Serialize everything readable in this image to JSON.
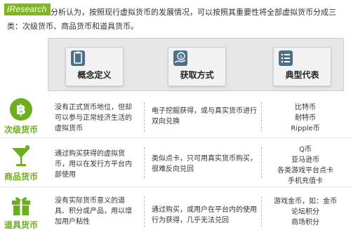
{
  "logo": {
    "i": "i",
    "rest": "Research"
  },
  "intro": "分析认为，按照现行虚拟货币的发展情况，可以按照其重要性将全部虚拟货币分成三类：次级货币、商品货币和道具货币。",
  "columns": [
    {
      "label": "概念定义",
      "icon": "clipboard-icon"
    },
    {
      "label": "获取方式",
      "icon": "money-hand-icon"
    },
    {
      "label": "典型代表",
      "icon": "list-icon"
    }
  ],
  "rows": [
    {
      "category": "次级货币",
      "icon": "bitcoin-icon",
      "definition": "没有正式货币地位，但却可以参与正常经济生活的虚拟货币",
      "acquisition": "电子挖掘获得，或与真实货币进行双向兑换",
      "examples": [
        "比特币",
        "耐特币",
        "Ripple币"
      ]
    },
    {
      "category": "商品货币",
      "icon": "cocktail-icon",
      "definition": "通过购买获得的虚拟货币，用以在发行方平台内部使用",
      "acquisition": "类似点卡，只可用真实货币购买，很难反向兑回",
      "examples": [
        "Q币",
        "亚马逊币",
        "各类游戏平台点卡",
        "手机充值卡"
      ]
    },
    {
      "category": "道具货币",
      "icon": "gift-icon",
      "definition": "没有实际货币意义的道具、积分或产品，用以增加用户粘性",
      "acquisition": "通过购买，或用户在平台内的使用行为获得，几乎无法兑回",
      "examples": [
        "游戏金币，如：金币",
        "论坛积分",
        "商场积分"
      ]
    }
  ],
  "colors": {
    "accent_green": "#6cae1c",
    "icon_blue": "#4d6f88",
    "logo_green": "#7fb71f"
  }
}
